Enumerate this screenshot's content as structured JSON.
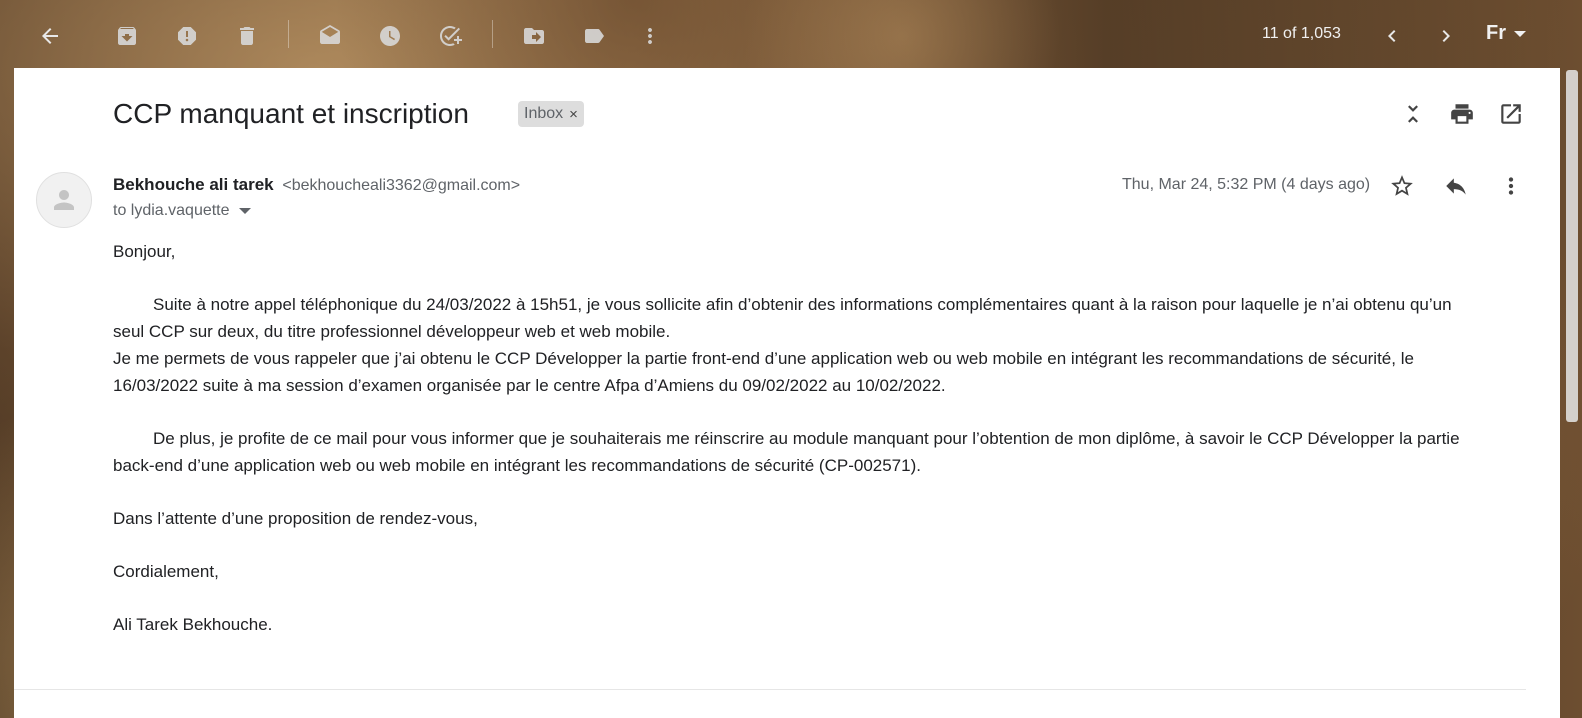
{
  "toolbar": {
    "counter": "11 of 1,053",
    "font_selector": "Fr",
    "icons": [
      "back-arrow-icon",
      "archive-icon",
      "report-spam-icon",
      "delete-icon",
      "mark-unread-icon",
      "snooze-icon",
      "add-to-tasks-icon",
      "move-to-icon",
      "labels-icon",
      "more-vert-icon",
      "prev-chevron-icon",
      "next-chevron-icon"
    ]
  },
  "message": {
    "subject": "CCP manquant et inscription",
    "label": "Inbox",
    "label_remove": "×",
    "sender_name": "Bekhouche ali tarek",
    "sender_email": "<bekhoucheali3362@gmail.com>",
    "to": "to lydia.vaquette",
    "date": "Thu, Mar 24, 5:32 PM (4 days ago)",
    "body": {
      "greeting": "Bonjour,",
      "p1_line1": "Suite à notre appel téléphonique du 24/03/2022 à 15h51, je vous sollicite afin d’obtenir des informations complémentaires quant à la raison pour laquelle je n’ai obtenu qu’un",
      "p1_line2": "seul CCP sur deux, du titre professionnel développeur web et web mobile.",
      "p2_line1": "Je me permets de vous rappeler que j’ai obtenu le CCP Développer la partie front-end d’une application web ou web mobile en intégrant les recommandations de sécurité, le",
      "p2_line2": "16/03/2022 suite à ma session d’examen organisée par le centre Afpa d’Amiens du 09/02/2022 au 10/02/2022.",
      "p3_line1": "De plus, je profite de ce mail pour vous informer que je souhaiterais me réinscrire au module manquant pour l’obtention de mon diplôme, à savoir le CCP Développer la partie",
      "p3_line2": "back-end d’une application web ou web mobile en intégrant les recommandations de sécurité (CP-002571).",
      "closing1": "Dans l’attente d’une proposition de rendez-vous,",
      "closing2": "Cordialement,",
      "signature": "Ali Tarek Bekhouche."
    }
  }
}
